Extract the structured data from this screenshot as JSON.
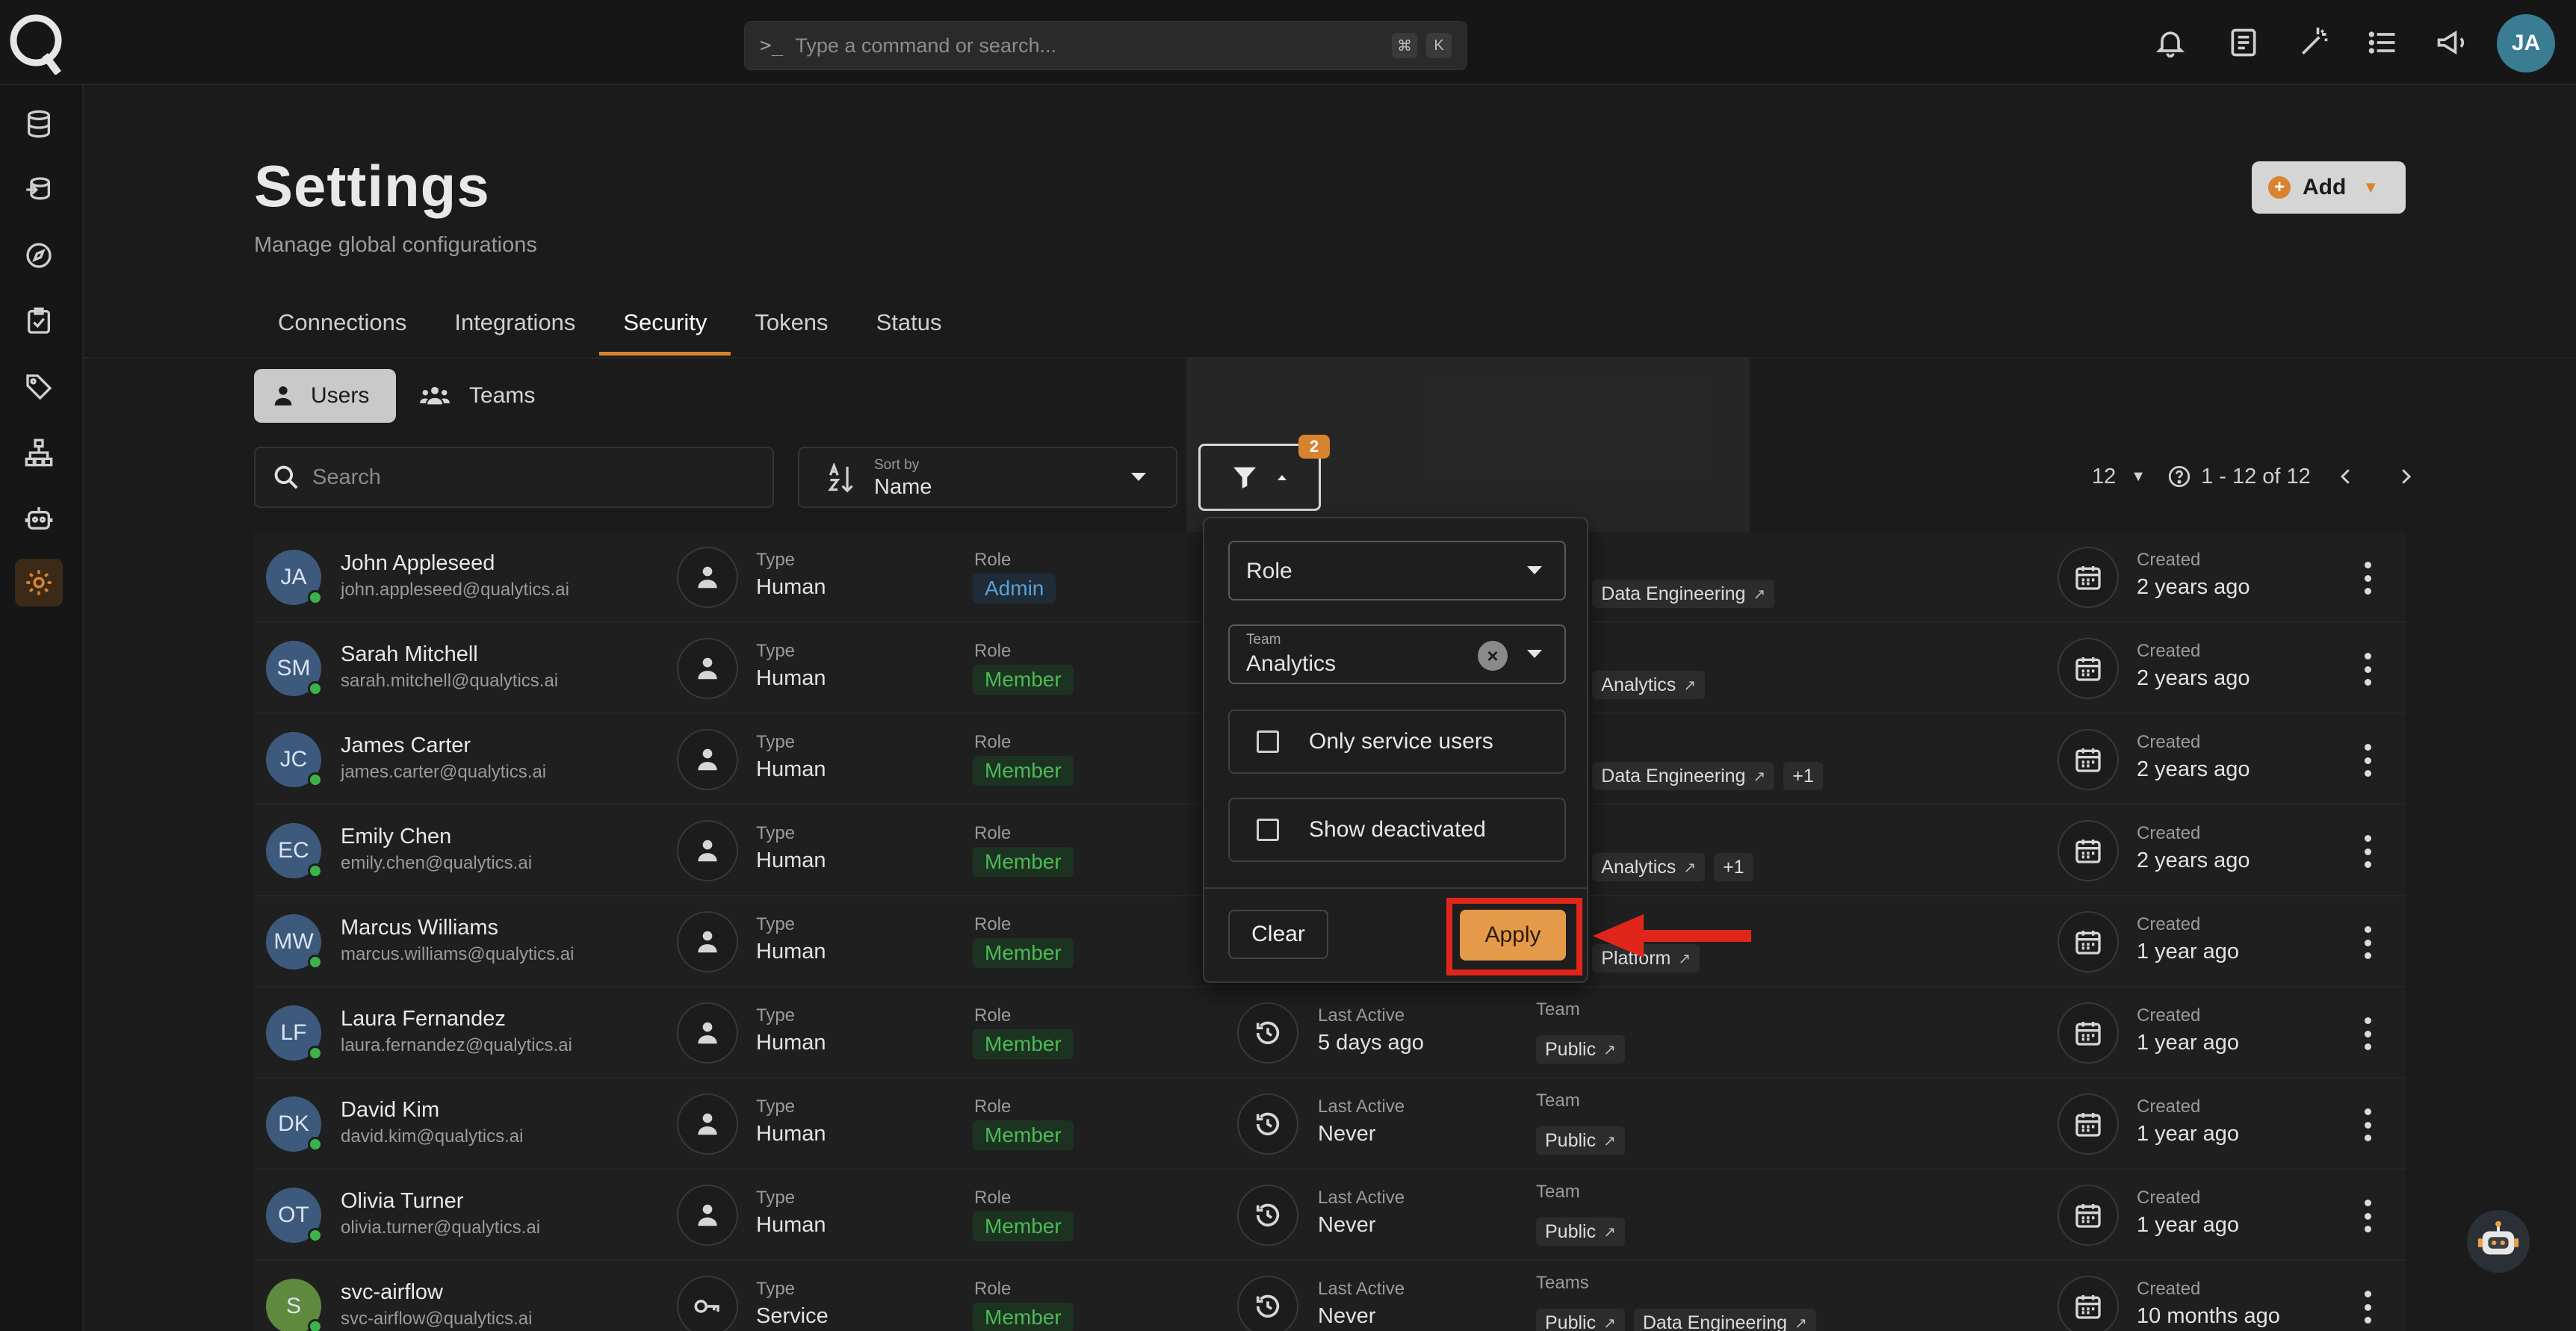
{
  "topbar": {
    "command_placeholder": "Type a command or search...",
    "shortcut_keys": [
      "⌘",
      "K"
    ],
    "avatar_initials": "JA"
  },
  "header": {
    "title": "Settings",
    "subtitle": "Manage global configurations",
    "add_label": "Add"
  },
  "tabs": [
    {
      "label": "Connections",
      "active": false
    },
    {
      "label": "Integrations",
      "active": false
    },
    {
      "label": "Security",
      "active": true
    },
    {
      "label": "Tokens",
      "active": false
    },
    {
      "label": "Status",
      "active": false
    }
  ],
  "subtabs": {
    "users": "Users",
    "teams": "Teams"
  },
  "toolbar": {
    "search_placeholder": "Search",
    "sort_label": "Sort by",
    "sort_value": "Name",
    "filter_count": "2",
    "page_size": "12",
    "range": "1 - 12 of 12"
  },
  "filter_popover": {
    "role_placeholder": "Role",
    "team_label": "Team",
    "team_value": "Analytics",
    "only_service_users": "Only service users",
    "show_deactivated": "Show deactivated",
    "clear_label": "Clear",
    "apply_label": "Apply"
  },
  "labels": {
    "type": "Type",
    "role": "Role",
    "last_active": "Last Active",
    "team": "Team",
    "teams": "Teams",
    "created": "Created"
  },
  "users": [
    {
      "initials": "JA",
      "name": "John Appleseed",
      "email": "john.appleseed@qualytics.ai",
      "type": "Human",
      "role": "Admin",
      "last_active": "",
      "team_label": "",
      "chips": [
        "c",
        "Data Engineering"
      ],
      "created": "2 years ago"
    },
    {
      "initials": "SM",
      "name": "Sarah Mitchell",
      "email": "sarah.mitchell@qualytics.ai",
      "type": "Human",
      "role": "Member",
      "last_active": "",
      "team_label": "",
      "chips": [
        "c",
        "Analytics"
      ],
      "created": "2 years ago"
    },
    {
      "initials": "JC",
      "name": "James Carter",
      "email": "james.carter@qualytics.ai",
      "type": "Human",
      "role": "Member",
      "last_active": "",
      "team_label": "",
      "chips": [
        "c",
        "Data Engineering",
        "+1"
      ],
      "created": "2 years ago"
    },
    {
      "initials": "EC",
      "name": "Emily Chen",
      "email": "emily.chen@qualytics.ai",
      "type": "Human",
      "role": "Member",
      "last_active": "",
      "team_label": "",
      "chips": [
        "c",
        "Analytics",
        "+1"
      ],
      "created": "2 years ago"
    },
    {
      "initials": "MW",
      "name": "Marcus Williams",
      "email": "marcus.williams@qualytics.ai",
      "type": "Human",
      "role": "Member",
      "last_active": "",
      "team_label": "",
      "chips": [
        "c",
        "Platform"
      ],
      "created": "1 year ago"
    },
    {
      "initials": "LF",
      "name": "Laura Fernandez",
      "email": "laura.fernandez@qualytics.ai",
      "type": "Human",
      "role": "Member",
      "last_active": "5 days ago",
      "team_label": "Team",
      "chips": [
        "Public"
      ],
      "created": "1 year ago"
    },
    {
      "initials": "DK",
      "name": "David Kim",
      "email": "david.kim@qualytics.ai",
      "type": "Human",
      "role": "Member",
      "last_active": "Never",
      "team_label": "Team",
      "chips": [
        "Public"
      ],
      "created": "1 year ago"
    },
    {
      "initials": "OT",
      "name": "Olivia Turner",
      "email": "olivia.turner@qualytics.ai",
      "type": "Human",
      "role": "Member",
      "last_active": "Never",
      "team_label": "Team",
      "chips": [
        "Public"
      ],
      "created": "1 year ago"
    },
    {
      "initials": "S",
      "name": "svc-airflow",
      "email": "svc-airflow@qualytics.ai",
      "type": "Service",
      "role": "Member",
      "last_active": "Never",
      "team_label": "Teams",
      "chips": [
        "Public",
        "Data Engineering"
      ],
      "created": "10 months ago"
    }
  ],
  "colors": {
    "accent": "#d8832f",
    "highlight": "#e0261b",
    "member": "#4cba55",
    "admin": "#5aa0d8"
  }
}
